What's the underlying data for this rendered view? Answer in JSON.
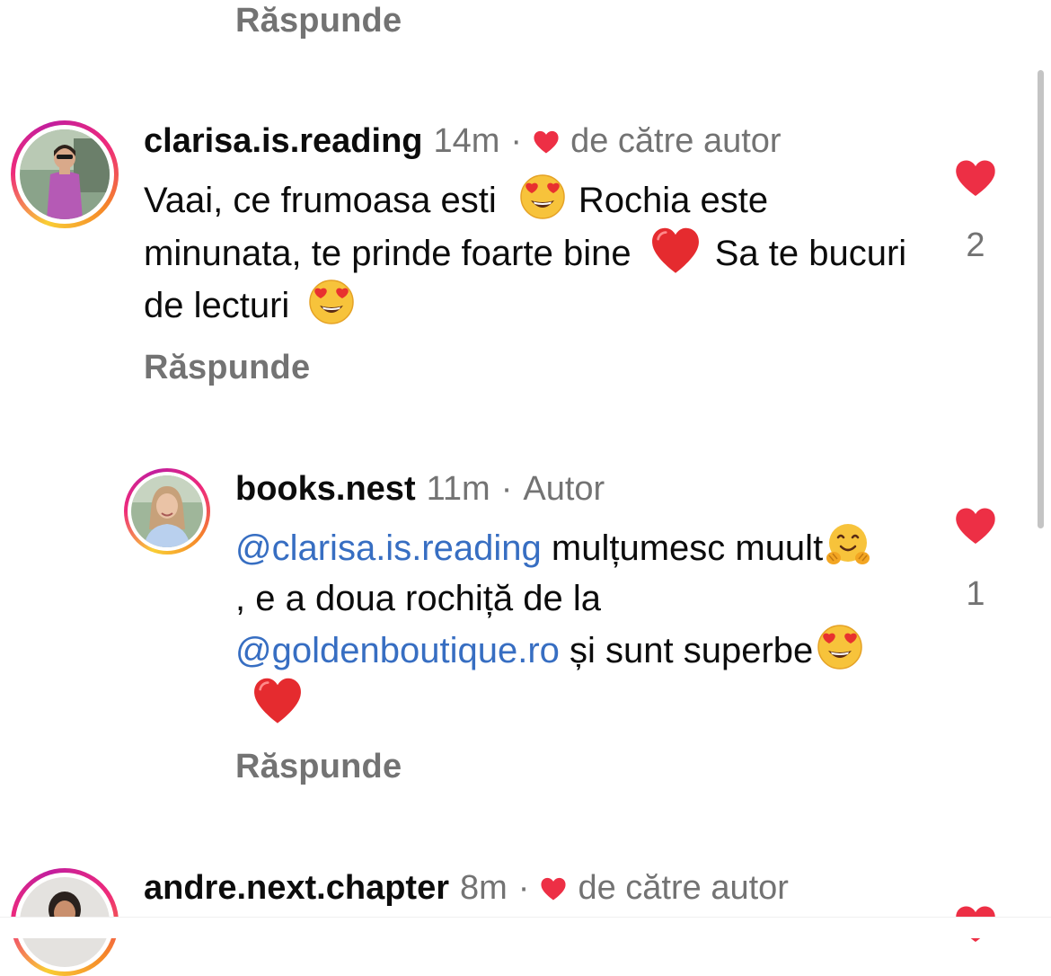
{
  "top_reply": {
    "label": "Răspunde"
  },
  "comments": [
    {
      "username": "clarisa.is.reading",
      "time": "14m",
      "liked_by_author": "de către autor",
      "body": {
        "part1": "Vaai, ce frumoasa esti",
        "part2": "Rochia este minunata, te prinde foarte bine",
        "part3": "Sa te bucuri de lecturi"
      },
      "likes": "2",
      "reply_label": "Răspunde"
    },
    {
      "username": "books.nest",
      "time": "11m",
      "author_badge": "Autor",
      "body": {
        "mention1": "@clarisa.is.reading",
        "part1": "mulțumesc muult",
        "part2": ", e a doua rochiță de la",
        "mention2": "@goldenboutique.ro",
        "part3": "și sunt superbe"
      },
      "likes": "1",
      "reply_label": "Răspunde"
    },
    {
      "username": "andre.next.chapter",
      "time": "8m",
      "liked_by_author": "de către autor"
    }
  ],
  "colors": {
    "heart_red": "#ed2f45",
    "mention_blue": "#376ec2",
    "meta_gray": "#737373"
  },
  "icons": {
    "meta_heart": "heart-icon",
    "like": "heart-icon",
    "emoji_heart_eyes": "heart-eyes-emoji",
    "emoji_red_heart": "red-heart-emoji",
    "emoji_hug": "hugging-face-emoji"
  }
}
